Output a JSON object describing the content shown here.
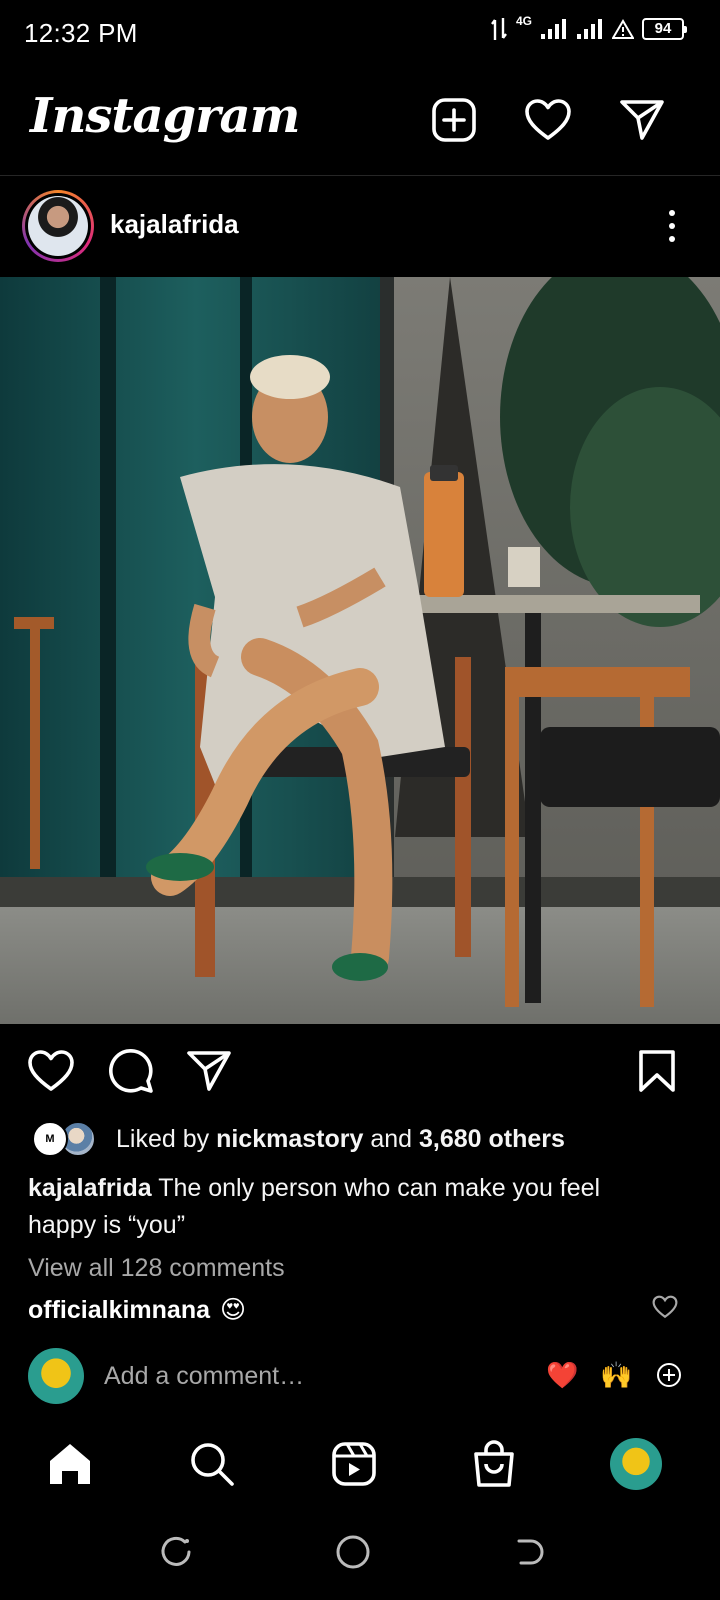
{
  "status_bar": {
    "time": "12:32 PM",
    "network": "4G",
    "battery": "94"
  },
  "header": {
    "logo_text": "Instagram",
    "icons": [
      "add-post-icon",
      "heart-icon",
      "send-icon"
    ]
  },
  "post": {
    "username": "kajalafrida",
    "image_alt": "kajalafrida post photo",
    "likes": {
      "prefix": "Liked by",
      "liked_by": "nickmastory",
      "conjunction": "and",
      "others": "3,680 others"
    },
    "caption": {
      "username": "kajalafrida",
      "text": "The only person who can make you feel happy is “you”"
    },
    "view_comments": "View all 128 comments",
    "comments": [
      {
        "username": "officialkimnana",
        "emoji": "😍"
      }
    ],
    "add_comment_placeholder": "Add a comment…",
    "quick_reactions": [
      "❤️",
      "🙌"
    ]
  },
  "bottom_nav": [
    "home-icon",
    "search-icon",
    "reels-icon",
    "shop-icon",
    "profile-avatar"
  ],
  "colors": {
    "background": "#000000",
    "text": "#ffffff",
    "muted": "#a8a8a8",
    "story_ring_start": "#f58529",
    "story_ring_end": "#8134af"
  }
}
